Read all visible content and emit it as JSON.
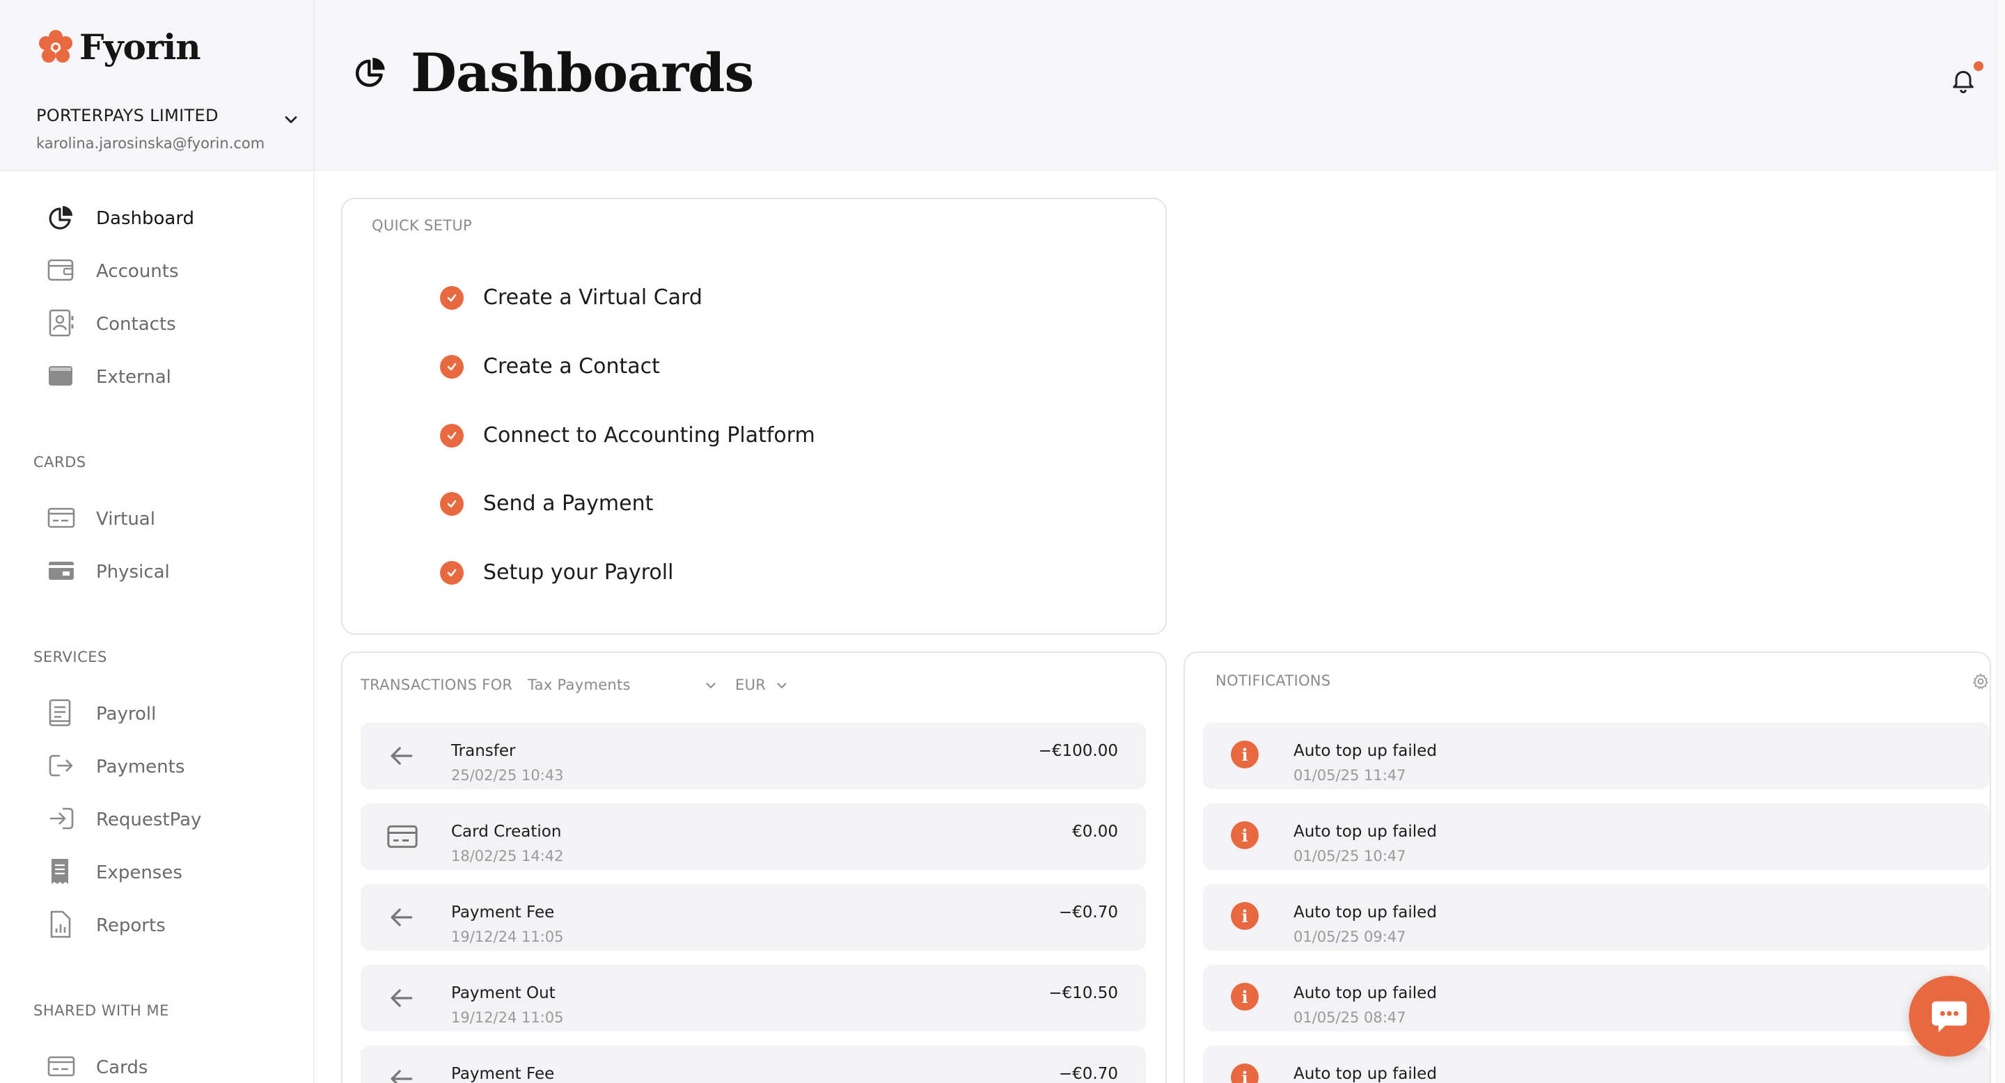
{
  "brand": {
    "name": "Fyorin",
    "accent": "#e8683f"
  },
  "org": {
    "name": "PORTERPAYS LIMITED",
    "email": "karolina.jarosinska@fyorin.com"
  },
  "nav": {
    "main": [
      {
        "label": "Dashboard",
        "icon": "pie-chart-icon",
        "active": true
      },
      {
        "label": "Accounts",
        "icon": "wallet-icon"
      },
      {
        "label": "Contacts",
        "icon": "contact-book-icon"
      },
      {
        "label": "External",
        "icon": "external-wallet-icon"
      }
    ],
    "cards_title": "CARDS",
    "cards": [
      {
        "label": "Virtual",
        "icon": "virtual-card-icon"
      },
      {
        "label": "Physical",
        "icon": "physical-card-icon"
      }
    ],
    "services_title": "SERVICES",
    "services": [
      {
        "label": "Payroll",
        "icon": "payroll-icon"
      },
      {
        "label": "Payments",
        "icon": "payments-icon"
      },
      {
        "label": "RequestPay",
        "icon": "request-pay-icon"
      },
      {
        "label": "Expenses",
        "icon": "receipt-icon"
      },
      {
        "label": "Reports",
        "icon": "report-icon"
      }
    ],
    "shared_title": "SHARED WITH ME",
    "shared": [
      {
        "label": "Cards",
        "icon": "shared-card-icon"
      }
    ]
  },
  "header": {
    "title": "Dashboards"
  },
  "quick_setup": {
    "title": "QUICK SETUP",
    "items": [
      "Create a Virtual Card",
      "Create a Contact",
      "Connect to Accounting Platform",
      "Send a Payment",
      "Setup your Payroll"
    ]
  },
  "transactions": {
    "title": "TRANSACTIONS FOR",
    "account": "Tax Payments",
    "currency": "EUR",
    "rows": [
      {
        "icon": "arrow-left-icon",
        "title": "Transfer",
        "date": "25/02/25 10:43",
        "amount": "−€100.00"
      },
      {
        "icon": "card-icon",
        "title": "Card Creation",
        "date": "18/02/25 14:42",
        "amount": "€0.00"
      },
      {
        "icon": "arrow-left-icon",
        "title": "Payment Fee",
        "date": "19/12/24 11:05",
        "amount": "−€0.70"
      },
      {
        "icon": "arrow-left-icon",
        "title": "Payment Out",
        "date": "19/12/24 11:05",
        "amount": "−€10.50"
      },
      {
        "icon": "arrow-left-icon",
        "title": "Payment Fee",
        "date": "",
        "amount": "−€0.70"
      }
    ]
  },
  "notifications": {
    "title": "NOTIFICATIONS",
    "rows": [
      {
        "title": "Auto top up failed",
        "date": "01/05/25 11:47"
      },
      {
        "title": "Auto top up failed",
        "date": "01/05/25 10:47"
      },
      {
        "title": "Auto top up failed",
        "date": "01/05/25 09:47"
      },
      {
        "title": "Auto top up failed",
        "date": "01/05/25 08:47"
      },
      {
        "title": "Auto top up failed",
        "date": ""
      }
    ]
  }
}
